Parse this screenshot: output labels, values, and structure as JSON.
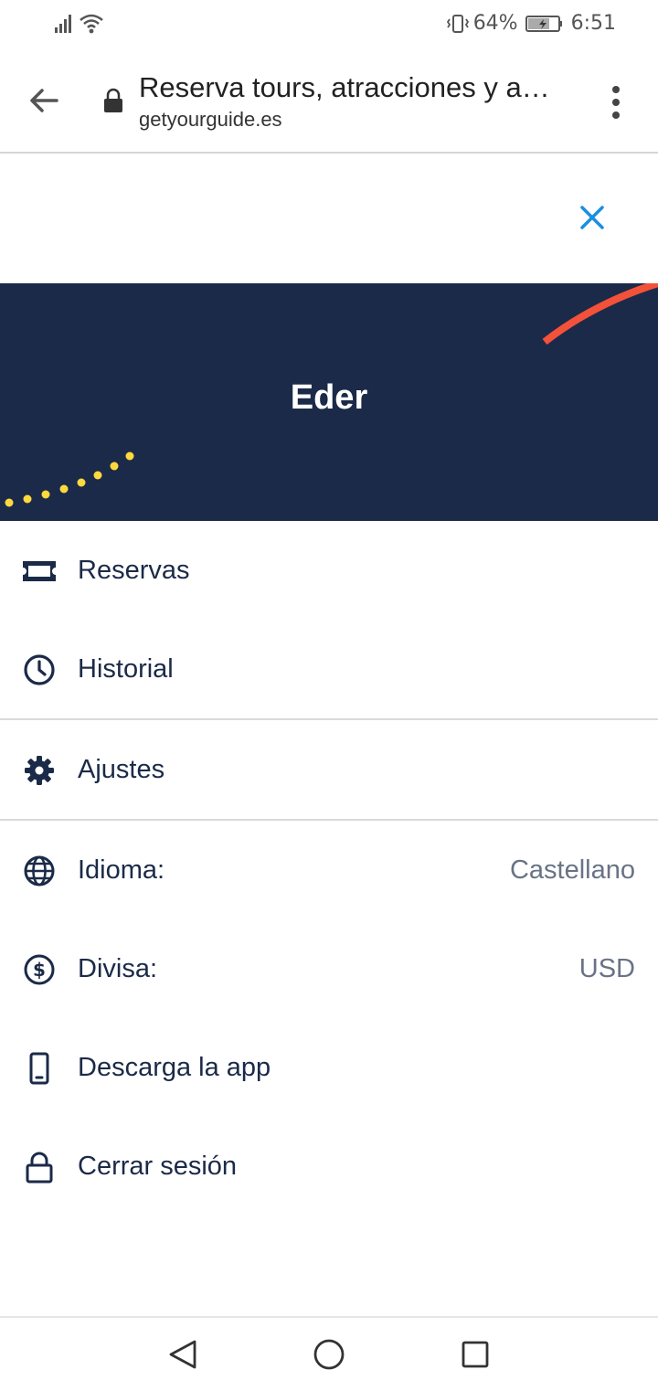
{
  "status_bar": {
    "battery": "64%",
    "time": "6:51"
  },
  "browser": {
    "title": "Reserva tours, atracciones y a…",
    "domain": "getyourguide.es"
  },
  "hero": {
    "user_name": "Eder"
  },
  "menu": {
    "reservas": "Reservas",
    "historial": "Historial",
    "ajustes": "Ajustes",
    "idioma_label": "Idioma:",
    "idioma_value": "Castellano",
    "divisa_label": "Divisa:",
    "divisa_value": "USD",
    "descarga": "Descarga la app",
    "cerrar": "Cerrar sesión"
  },
  "colors": {
    "navy": "#1b2a48",
    "accent_blue": "#1a8fe0",
    "orange": "#f4513a",
    "yellow": "#ffd93d"
  },
  "icons": [
    "signal-icon",
    "wifi-icon",
    "vibrate-icon",
    "battery-icon",
    "back-arrow-icon",
    "lock-icon",
    "more-vert-icon",
    "close-icon",
    "ticket-icon",
    "clock-icon",
    "gear-icon",
    "globe-icon",
    "dollar-icon",
    "phone-icon",
    "padlock-icon",
    "nav-back-icon",
    "nav-home-icon",
    "nav-recents-icon"
  ]
}
